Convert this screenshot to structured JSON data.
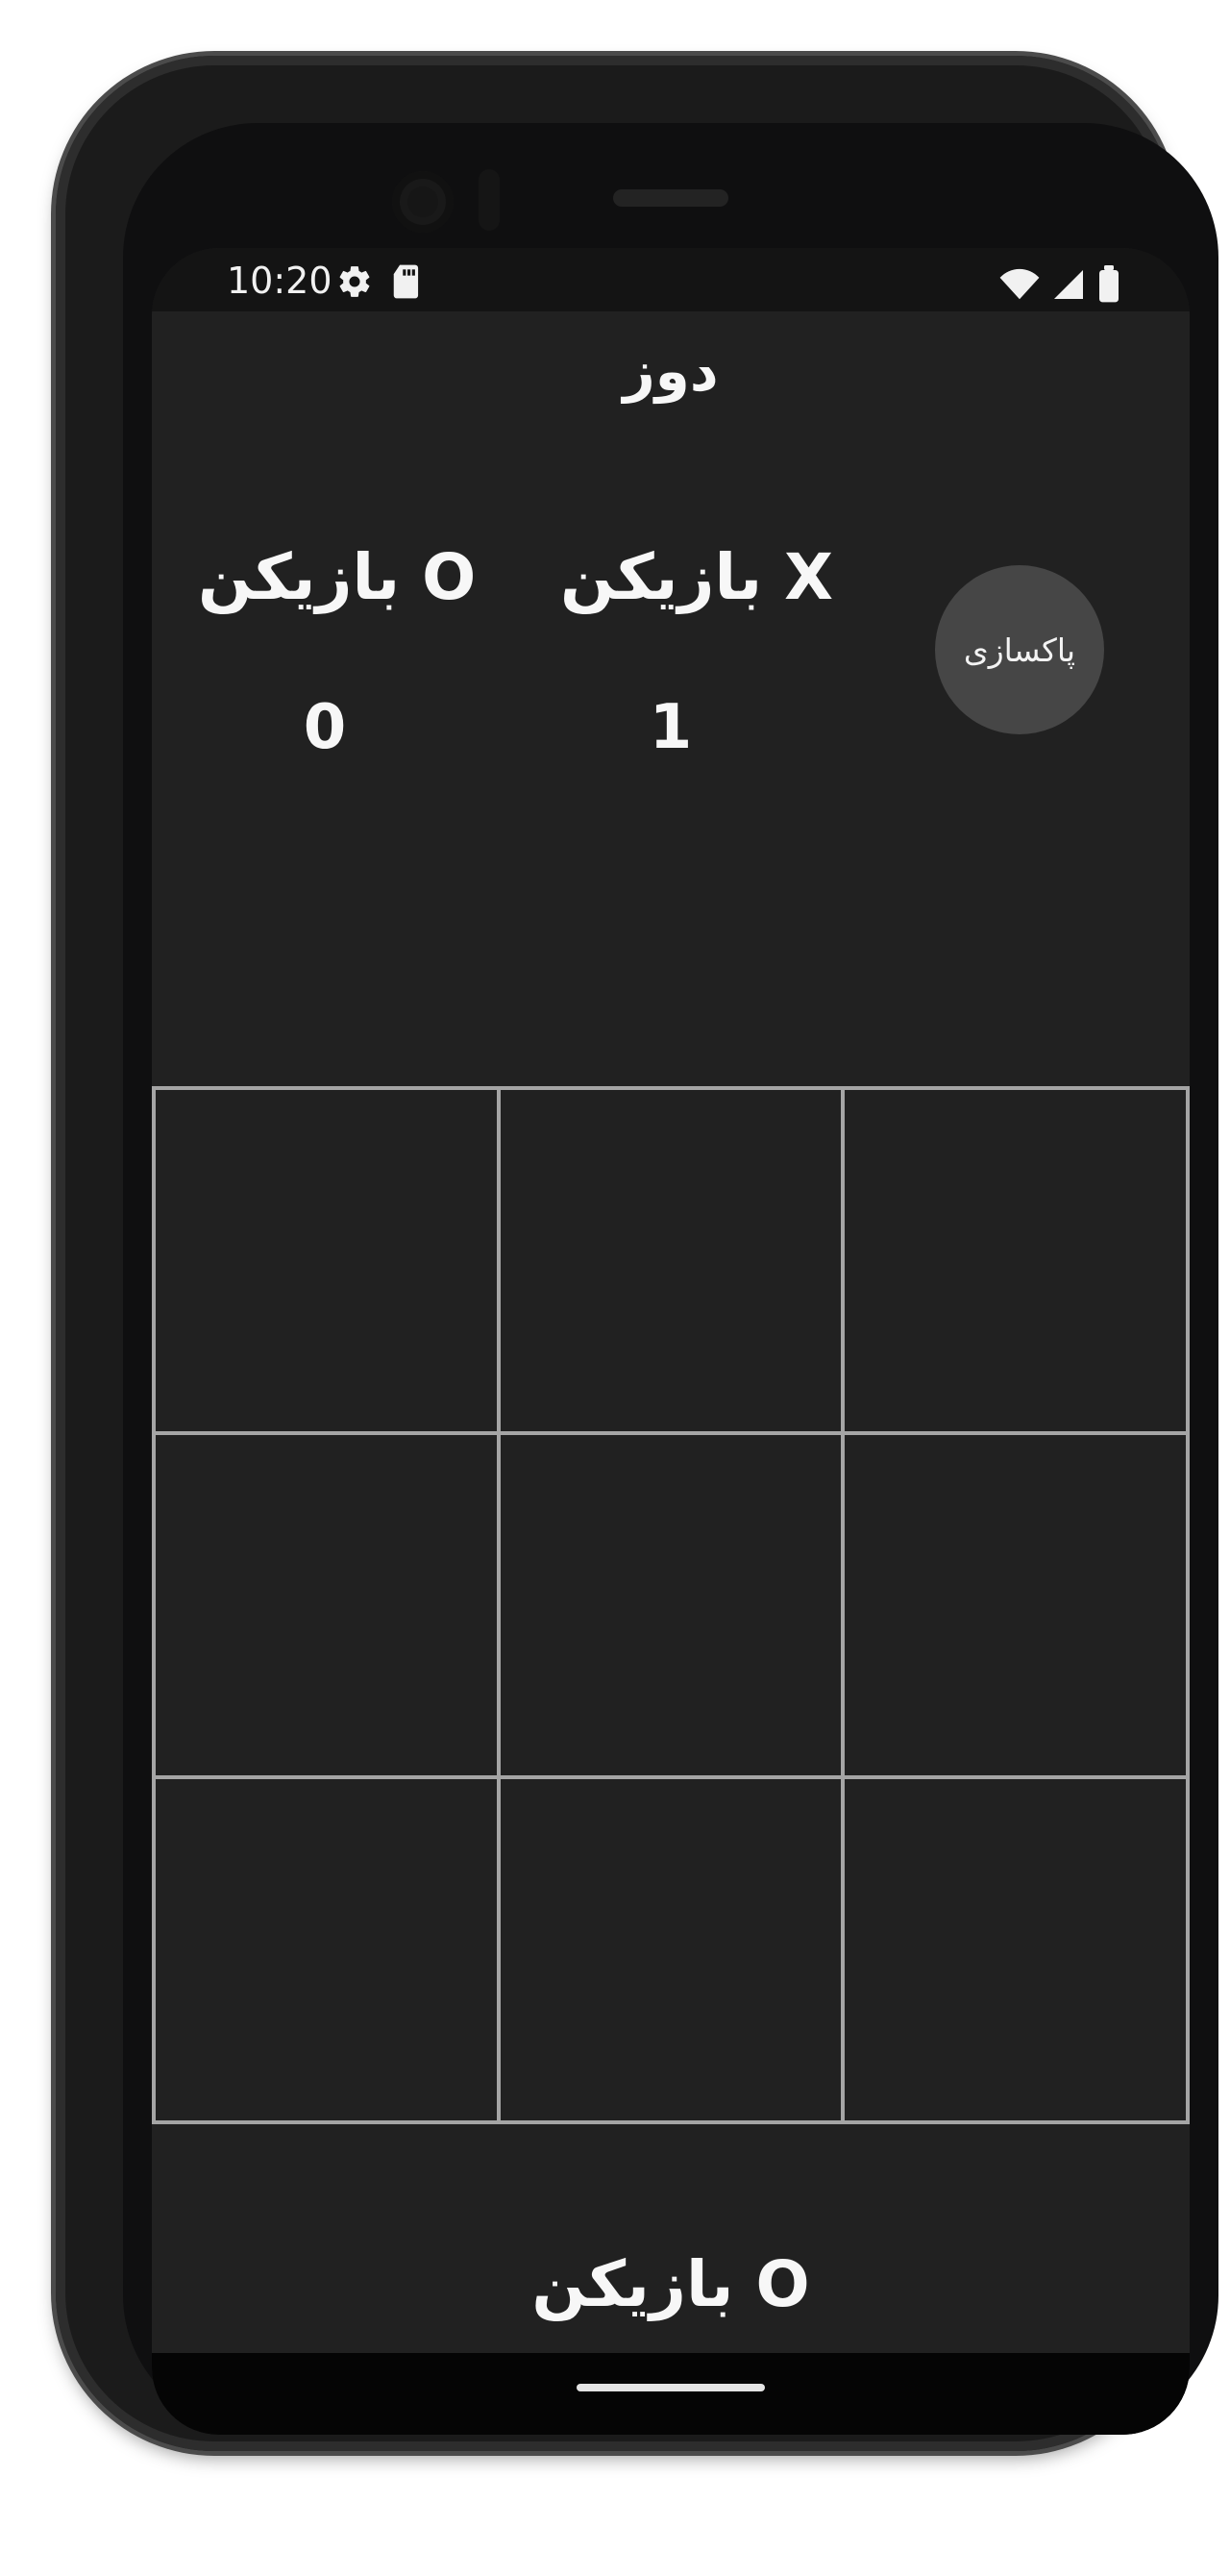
{
  "status_bar": {
    "time": "10:20",
    "left_icons": [
      "settings-icon",
      "sd-card-icon"
    ],
    "right_icons": [
      "wifi-icon",
      "signal-icon",
      "battery-icon"
    ]
  },
  "app": {
    "title": "دوز",
    "players": {
      "o_label": "بازیکن O",
      "x_label": "بازیکن X",
      "o_score": "0",
      "x_score": "1"
    },
    "reset_button": "پاکسازی",
    "board": [
      "",
      "",
      "",
      "",
      "",
      "",
      "",
      "",
      ""
    ],
    "current_turn_text": "بازیکن O"
  },
  "colors": {
    "background": "#212121",
    "board_lines": "#a5a5a5",
    "reset_button": "#464646",
    "text": "#f7f7f7"
  }
}
